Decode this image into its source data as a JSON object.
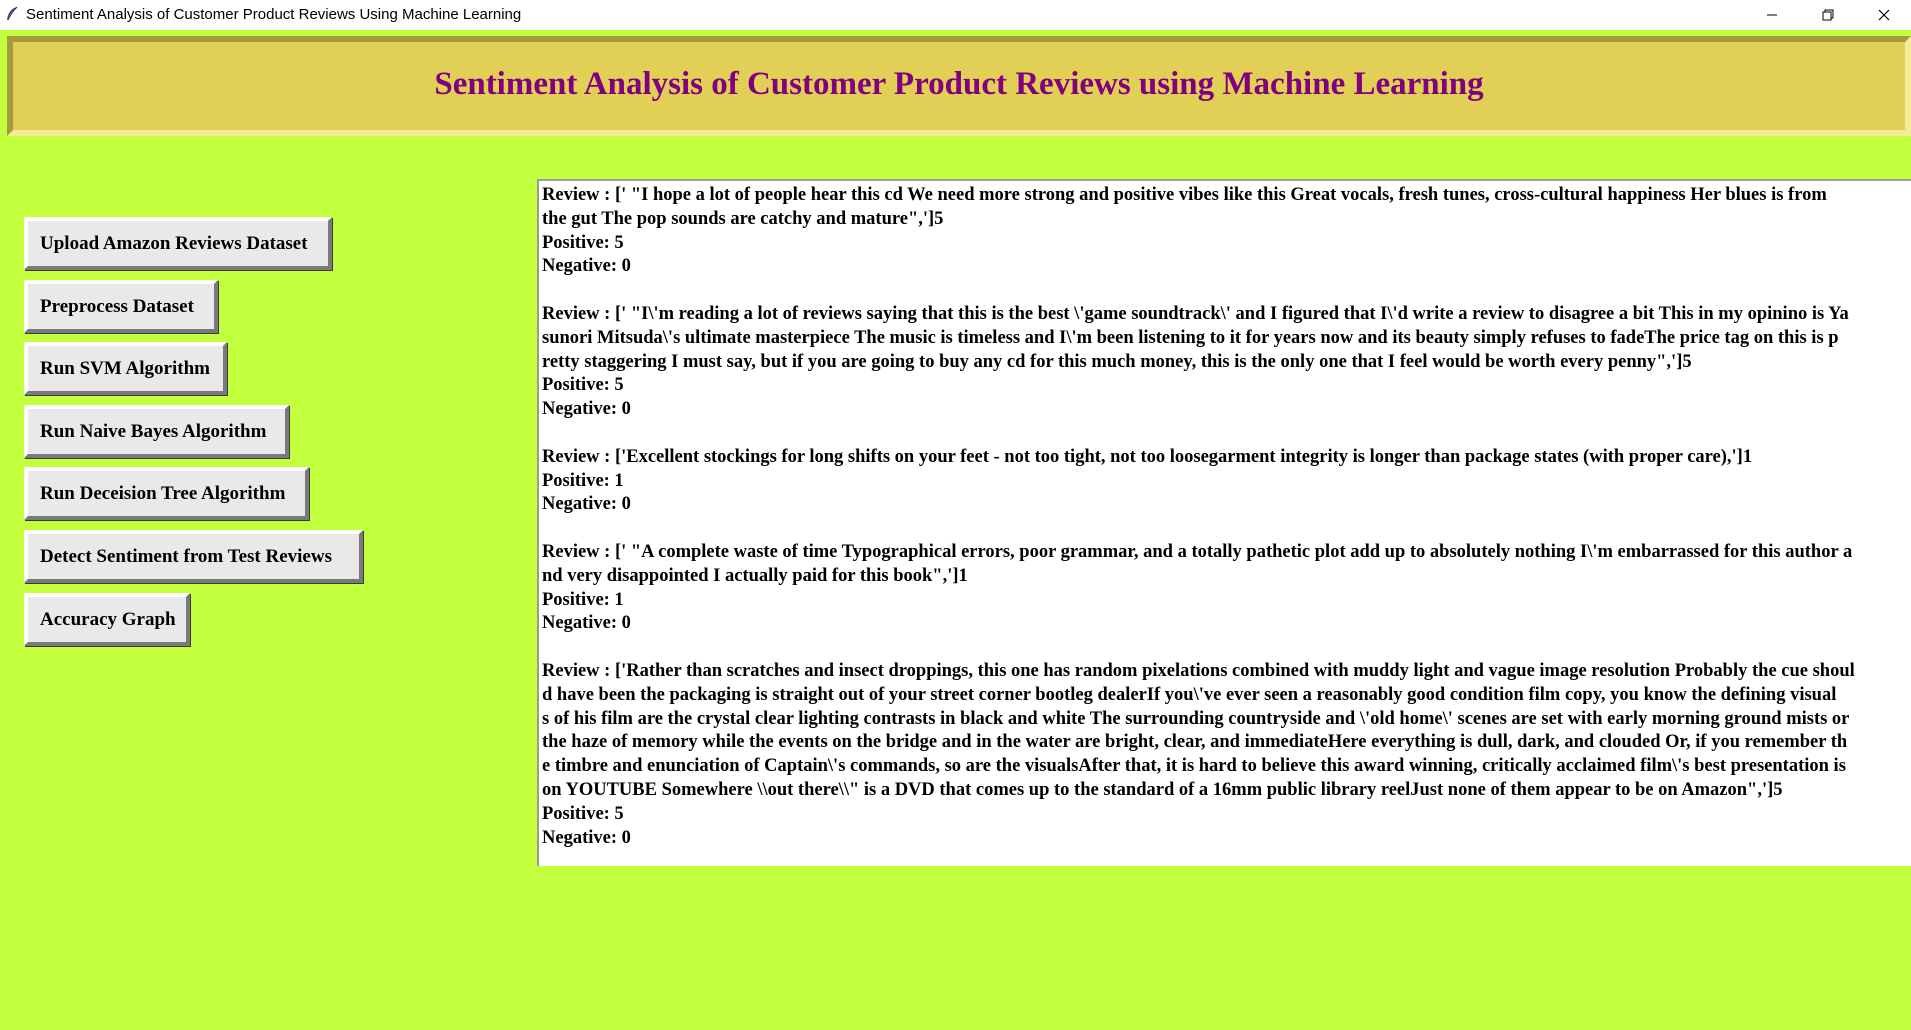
{
  "window": {
    "title": "Sentiment Analysis of Customer Product Reviews Using Machine Learning",
    "controls": {
      "minimize": "minimize-icon",
      "maximize": "restore-icon",
      "close": "close-icon"
    }
  },
  "header": {
    "title": "Sentiment Analysis of Customer Product Reviews using Machine Learning"
  },
  "buttons": {
    "upload": "Upload Amazon Reviews Dataset",
    "preprocess": "Preprocess Dataset",
    "svm": "Run SVM Algorithm",
    "naive_bayes": "Run Naive Bayes Algorithm",
    "decision_tree": "Run Deceision Tree Algorithm",
    "detect": "Detect Sentiment from Test Reviews",
    "accuracy_graph": "Accuracy Graph"
  },
  "output": {
    "lines": [
      "Review : [' \"I hope a lot of people hear this cd We need more strong and positive vibes like this Great vocals, fresh tunes, cross-cultural happiness Her blues is from",
      "the gut The pop sounds are catchy and mature\",']5",
      "Positive: 5",
      "Negative: 0",
      "",
      "Review : [' \"I\\'m reading a lot of reviews saying that this is the best \\'game soundtrack\\' and I figured that I\\'d write a review to disagree a bit This in my opinino is Ya",
      "sunori Mitsuda\\'s ultimate masterpiece The music is timeless and I\\'m been listening to it for years now and its beauty simply refuses to fadeThe price tag on this is p",
      "retty staggering I must say, but if you are going to buy any cd for this much money, this is the only one that I feel would be worth every penny\",']5",
      "Positive: 5",
      "Negative: 0",
      "",
      "Review : ['Excellent stockings for long shifts on your feet - not too tight, not too loosegarment integrity is longer than package states (with proper care),']1",
      "Positive: 1",
      "Negative: 0",
      "",
      "Review : [' \"A complete waste of time Typographical errors, poor grammar, and a totally pathetic plot add up to absolutely nothing I\\'m embarrassed for this author a",
      "nd very disappointed I actually paid for this book\",']1",
      "Positive: 1",
      "Negative: 0",
      "",
      "Review : ['Rather than scratches and insect droppings, this one has random pixelations combined with muddy light and vague image resolution Probably the cue shoul",
      "d have been the packaging is straight out of your street corner bootleg dealerIf you\\'ve ever seen a reasonably good condition film copy, you know the defining visual",
      "s of his film are the crystal clear lighting contrasts in black and white The surrounding countryside and \\'old home\\' scenes are set with early morning ground mists or",
      "the haze of memory while the events on the bridge and in the water are bright, clear, and immediateHere everything is dull, dark, and clouded Or, if you remember th",
      "e timbre and enunciation of Captain\\'s commands, so are the visualsAfter that, it is hard to believe this award winning, critically acclaimed film\\'s best presentation is",
      "on YOUTUBE Somewhere \\\\out there\\\\\" is a DVD that comes up to the standard of a 16mm public library reelJust none of them appear to be on Amazon\",']5",
      "Positive: 5",
      "Negative: 0"
    ]
  },
  "colors": {
    "background": "#c2ff3d",
    "header_bg": "#e2cf55",
    "header_text": "#800080",
    "button_bg": "#e9e9e9"
  }
}
